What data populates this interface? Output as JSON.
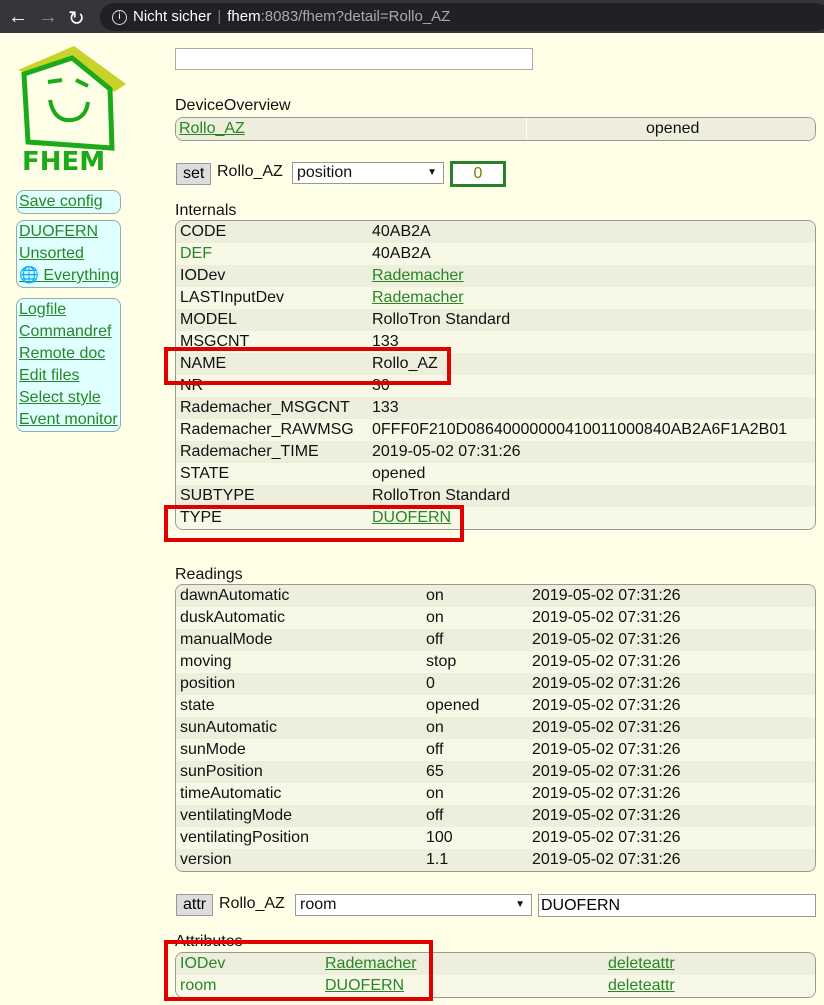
{
  "browser": {
    "security": "Nicht sicher",
    "host": "fhem",
    "url_rest": ":8083/fhem?detail=Rollo_AZ"
  },
  "logo_text": "FHEM",
  "menu": {
    "group1": [
      "Save config"
    ],
    "group2": [
      "DUOFERN",
      "Unsorted",
      "Everything"
    ],
    "group3": [
      "Logfile",
      "Commandref",
      "Remote doc",
      "Edit files",
      "Select style",
      "Event monitor"
    ]
  },
  "search": {
    "value": ""
  },
  "overview": {
    "title": "DeviceOverview",
    "device": "Rollo_AZ",
    "state": "opened"
  },
  "set": {
    "button": "set",
    "device": "Rollo_AZ",
    "option": "position",
    "value": "0"
  },
  "internals": {
    "title": "Internals",
    "rows": [
      [
        "CODE",
        "40AB2A"
      ],
      [
        "DEF",
        "40AB2A"
      ],
      [
        "IODev",
        "Rademacher"
      ],
      [
        "LASTInputDev",
        "Rademacher"
      ],
      [
        "MODEL",
        "RolloTron Standard"
      ],
      [
        "MSGCNT",
        "133"
      ],
      [
        "NAME",
        "Rollo_AZ"
      ],
      [
        "NR",
        "30"
      ],
      [
        "Rademacher_MSGCNT",
        "133"
      ],
      [
        "Rademacher_RAWMSG",
        "0FFF0F210D08640000000410011000840AB2A6F1A2B01"
      ],
      [
        "Rademacher_TIME",
        "2019-05-02 07:31:26"
      ],
      [
        "STATE",
        "opened"
      ],
      [
        "SUBTYPE",
        "RolloTron Standard"
      ],
      [
        "TYPE",
        "DUOFERN"
      ]
    ]
  },
  "readings": {
    "title": "Readings",
    "rows": [
      [
        "dawnAutomatic",
        "on",
        "2019-05-02 07:31:26"
      ],
      [
        "duskAutomatic",
        "on",
        "2019-05-02 07:31:26"
      ],
      [
        "manualMode",
        "off",
        "2019-05-02 07:31:26"
      ],
      [
        "moving",
        "stop",
        "2019-05-02 07:31:26"
      ],
      [
        "position",
        "0",
        "2019-05-02 07:31:26"
      ],
      [
        "state",
        "opened",
        "2019-05-02 07:31:26"
      ],
      [
        "sunAutomatic",
        "on",
        "2019-05-02 07:31:26"
      ],
      [
        "sunMode",
        "off",
        "2019-05-02 07:31:26"
      ],
      [
        "sunPosition",
        "65",
        "2019-05-02 07:31:26"
      ],
      [
        "timeAutomatic",
        "on",
        "2019-05-02 07:31:26"
      ],
      [
        "ventilatingMode",
        "off",
        "2019-05-02 07:31:26"
      ],
      [
        "ventilatingPosition",
        "100",
        "2019-05-02 07:31:26"
      ],
      [
        "version",
        "1.1",
        "2019-05-02 07:31:26"
      ]
    ]
  },
  "attr": {
    "button": "attr",
    "device": "Rollo_AZ",
    "option": "room",
    "value": "DUOFERN"
  },
  "attributes": {
    "title": "Attributes",
    "rows": [
      [
        "IODev",
        "Rademacher",
        "deleteattr"
      ],
      [
        "room",
        "DUOFERN",
        "deleteattr"
      ]
    ]
  }
}
